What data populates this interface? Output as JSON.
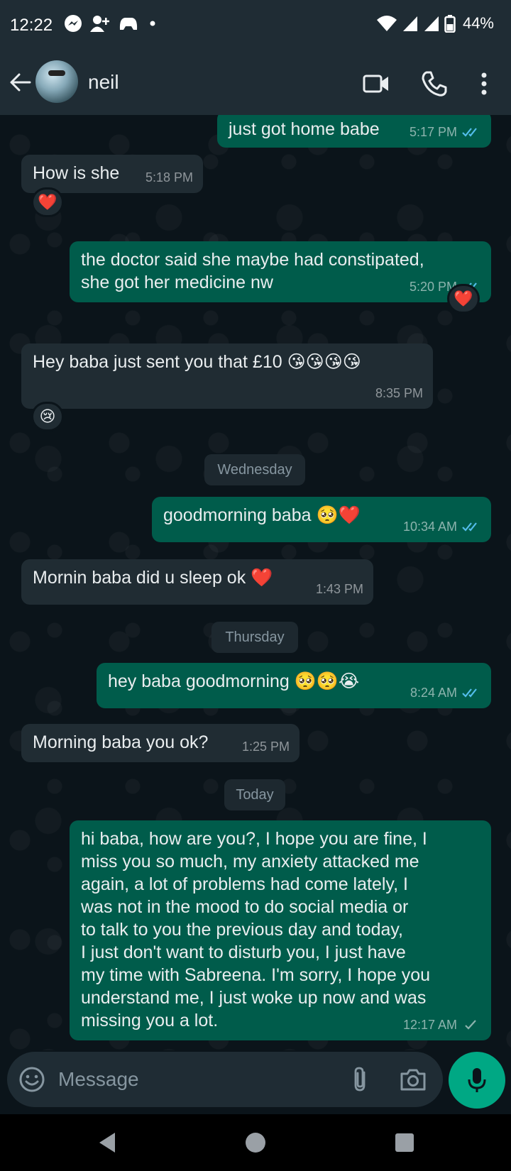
{
  "status_bar": {
    "time": "12:22",
    "battery": "44%",
    "left_icons": [
      "messenger-icon",
      "add-person-icon",
      "game-controller-icon",
      "dot-icon"
    ],
    "right_icons": [
      "wifi-icon",
      "signal-icon",
      "signal-icon",
      "battery-icon"
    ]
  },
  "header": {
    "contact_name": "neil",
    "icons": [
      "back-arrow-icon",
      "video-call-icon",
      "phone-icon",
      "more-vert-icon"
    ]
  },
  "messages": [
    {
      "dir": "out",
      "text": "just got home babe",
      "time": "5:17 PM",
      "status": "read"
    },
    {
      "dir": "in",
      "text": "How is she",
      "time": "5:18 PM",
      "reaction": "❤️"
    },
    {
      "dir": "out",
      "text": "the doctor said she maybe had constipated,\nshe got her medicine nw",
      "time": "5:20 PM",
      "status": "read",
      "reaction": "❤️"
    },
    {
      "dir": "in",
      "text": "Hey baba just sent you that £10 😘😘😘😘",
      "time": "8:35 PM",
      "reaction": "😢"
    },
    {
      "dir": "out",
      "text": "goodmorning baba 🥺❤️",
      "time": "10:34 AM",
      "status": "read"
    },
    {
      "dir": "in",
      "text": "Mornin baba did u sleep ok ❤️",
      "time": "1:43 PM"
    },
    {
      "dir": "out",
      "text": "hey baba goodmorning 🥺🥺😭",
      "time": "8:24 AM",
      "status": "read"
    },
    {
      "dir": "in",
      "text": "Morning baba you ok?",
      "time": "1:25 PM"
    },
    {
      "dir": "out",
      "text": "hi baba, how are you?, I hope you are fine, I\nmiss you so much, my anxiety attacked me\nagain,  a lot of problems had come lately, I\nwas not in the mood to do social media or\nto talk to you the previous day and today,\nI just don't want to disturb you, I just have\nmy time with Sabreena. I'm sorry, I hope you\nunderstand me, I just woke up now and was\nmissing you a lot.",
      "time": "12:17 AM",
      "status": "sent"
    }
  ],
  "day_chips": [
    "Wednesday",
    "Thursday",
    "Today"
  ],
  "input": {
    "placeholder": "Message",
    "icons": [
      "emoji-icon",
      "attach-icon",
      "camera-icon",
      "mic-icon"
    ]
  },
  "colors": {
    "outgoing_bubble": "#005c4b",
    "incoming_bubble": "#202c33",
    "read_tick": "#53bdeb",
    "accent": "#00a884"
  }
}
